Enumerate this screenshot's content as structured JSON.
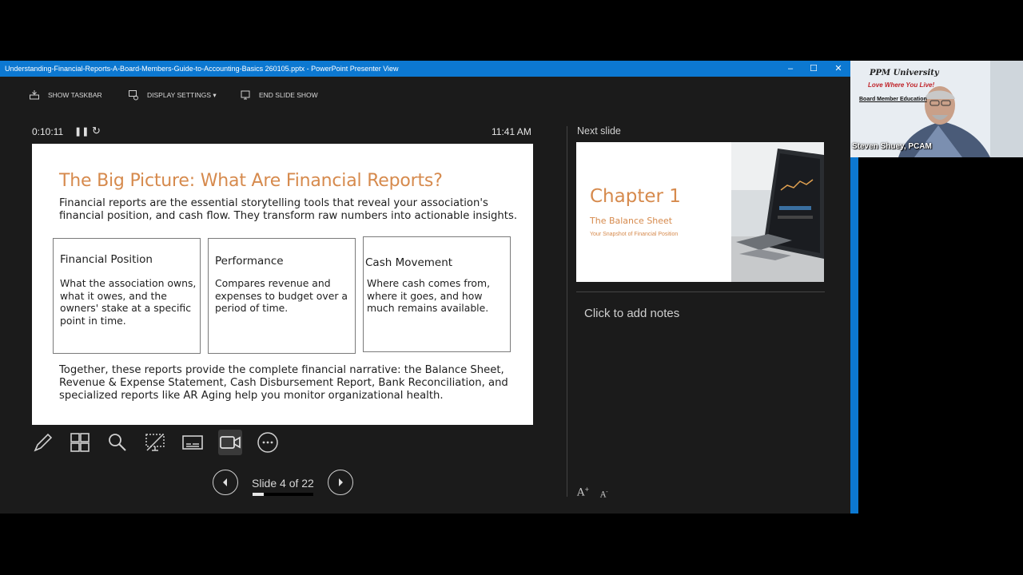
{
  "window": {
    "title": "Understanding-Financial-Reports-A-Board-Members-Guide-to-Accounting-Basics 260105.pptx - PowerPoint Presenter View",
    "controls": {
      "minimize": "–",
      "maximize": "☐",
      "close": "✕"
    }
  },
  "toolbar": {
    "show_taskbar": "SHOW TASKBAR",
    "display_settings": "DISPLAY SETTINGS ▾",
    "end_slide_show": "END SLIDE SHOW"
  },
  "presenter": {
    "elapsed": "0:10:11",
    "clock": "11:41 AM",
    "next_slide_label": "Next slide",
    "notes_placeholder": "Click to add notes",
    "slide_counter": "Slide 4 of 22",
    "progress": 0.18
  },
  "current_slide": {
    "title": "The Big Picture: What Are Financial Reports?",
    "intro_line1": "Financial reports are the essential storytelling tools that reveal your association's",
    "intro_line2": "financial position, and cash flow. They transform raw numbers into actionable insights.",
    "cards": [
      {
        "title": "Financial Position",
        "body": "What the association owns, what it owes, and the owners' stake at a specific point in time."
      },
      {
        "title": "Performance",
        "body": "Compares revenue and expenses to budget over a period of time."
      },
      {
        "title": "Cash Movement",
        "body": "Where cash comes from, where it goes, and how much remains available."
      }
    ],
    "summary_line1": "Together, these reports provide the complete financial narrative: the Balance Sheet,",
    "summary_line2": "Revenue & Expense Statement, Cash Disbursement Report, Bank Reconciliation, and",
    "summary_line3": "specialized reports like AR Aging help you monitor organizational health."
  },
  "next_slide": {
    "title": "Chapter 1",
    "subtitle": "The Balance Sheet",
    "tagline": "Your Snapshot of Financial Position"
  },
  "webcam": {
    "org": "PPM University",
    "slogan": "Love Where You Live!",
    "banner": "Board Member Education",
    "presenter_name": "Steven Shuey, PCAM"
  },
  "colors": {
    "accent": "#d68a4d",
    "titlebar": "#0c78d1",
    "background": "#1b1b1b"
  }
}
